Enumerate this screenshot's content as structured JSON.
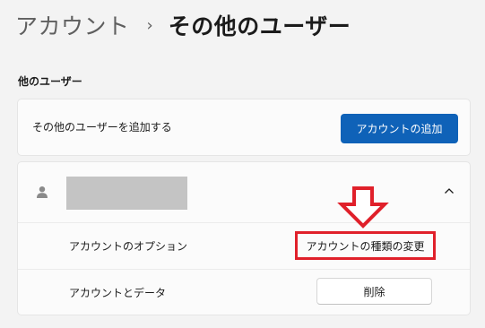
{
  "breadcrumb": {
    "parent": "アカウント",
    "separator": "›",
    "current": "その他のユーザー"
  },
  "section": {
    "label": "他のユーザー"
  },
  "add_user": {
    "label": "その他のユーザーを追加する",
    "button_label": "アカウントの追加"
  },
  "user_card": {
    "avatar_icon": "person-icon",
    "name_redacted": true,
    "expand_icon": "chevron-up-icon",
    "options_label": "アカウントのオプション",
    "change_type_label": "アカウントの種類の変更",
    "data_label": "アカウントとデータ",
    "delete_label": "削除"
  },
  "annotation": {
    "arrow_icon": "down-arrow-icon",
    "highlight_color": "#e0202a"
  },
  "colors": {
    "accent": "#0f62b8",
    "background": "#f3f3f3",
    "card": "#fbfbfb"
  }
}
